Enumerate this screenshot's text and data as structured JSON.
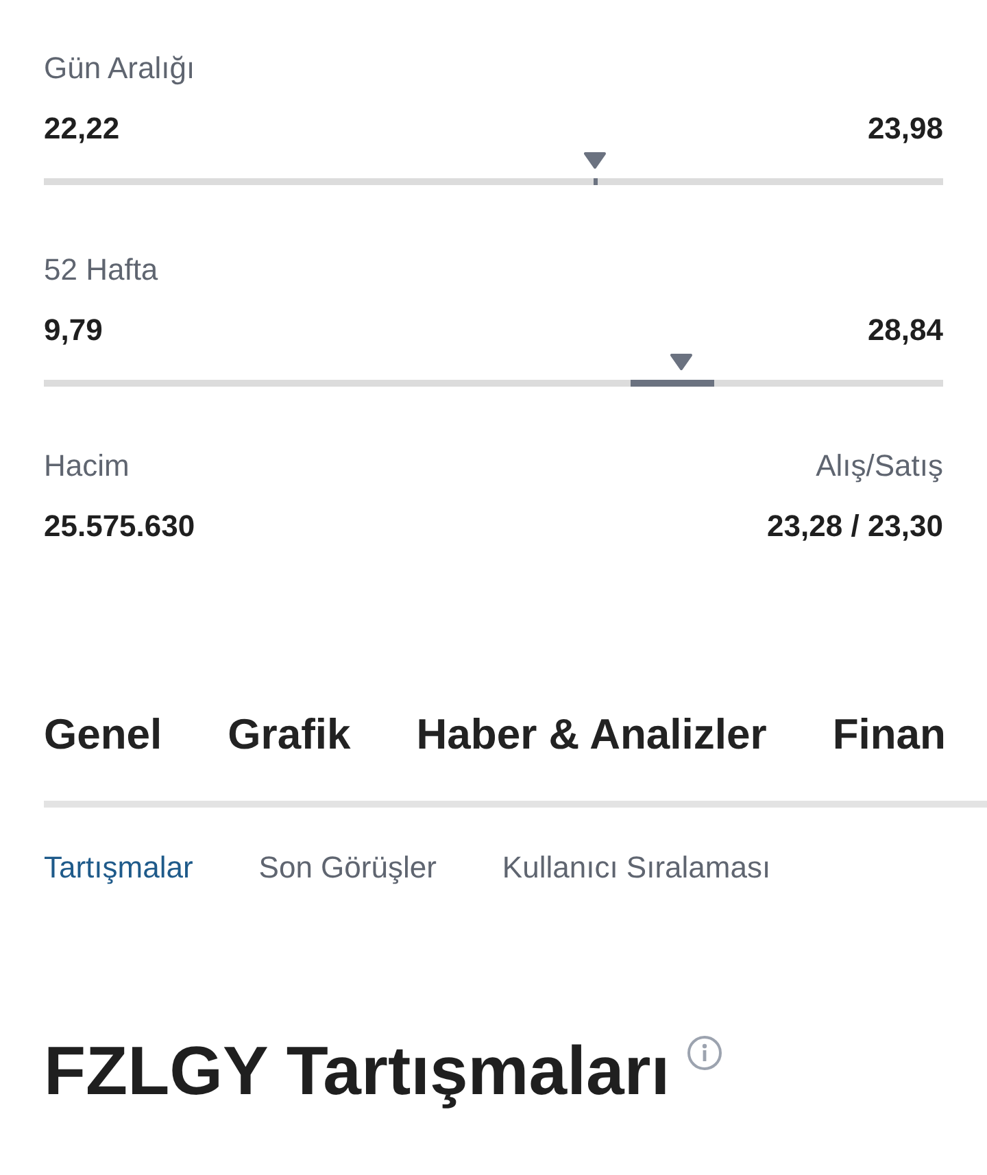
{
  "ranges": [
    {
      "label": "Gün Aralığı",
      "low": "22,22",
      "high": "23,98",
      "level": 0.613,
      "kind": "tick"
    },
    {
      "label": "52 Hafta",
      "low": "9,79",
      "high": "28,84",
      "level": 0.709,
      "kind": "band"
    }
  ],
  "stats": [
    {
      "label": "Hacim",
      "value": "25.575.630"
    },
    {
      "label": "Alış/Satış",
      "value": "23,28 / 23,30"
    }
  ],
  "tabs": [
    "Genel",
    "Grafik",
    "Haber & Analizler",
    "Finan"
  ],
  "subtabs": [
    {
      "label": "Tartışmalar",
      "selected": true
    },
    {
      "label": "Son Görüşler",
      "selected": false
    },
    {
      "label": "Kullanıcı Sıralaması",
      "selected": false
    }
  ],
  "heading": "FZLGY Tartışmaları"
}
